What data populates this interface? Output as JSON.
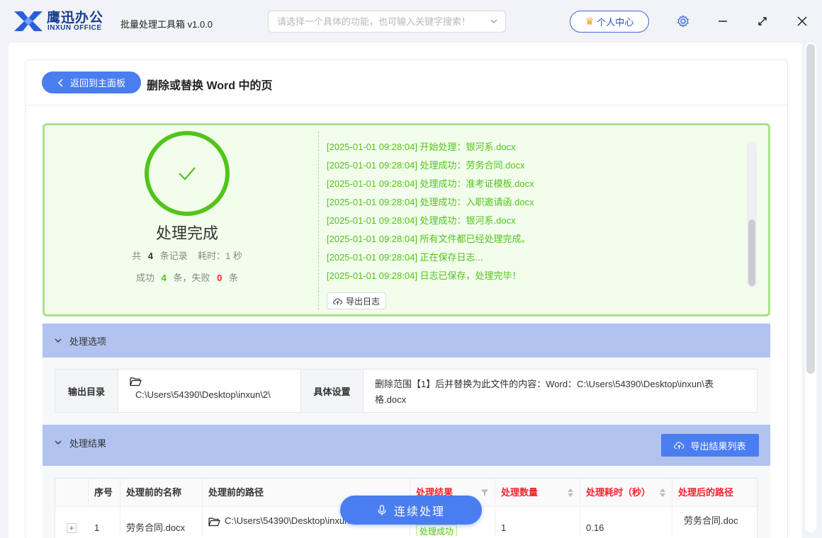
{
  "app": {
    "brand_cn": "鹰迅办公",
    "brand_en": "INXUN OFFICE",
    "title": "批量处理工具箱 v1.0.0"
  },
  "topbar": {
    "search_placeholder": "请选择一个具体的功能，也可输入关键字搜索！",
    "user_center": "个人中心"
  },
  "header": {
    "back_label": "返回到主面板",
    "page_title": "删除或替换 Word 中的页"
  },
  "result": {
    "status_title": "处理完成",
    "stat_total_prefix": "共",
    "total": "4",
    "stat_total_suffix": "条记录",
    "time_text": "耗时：1 秒",
    "success_prefix": "成功",
    "success": "4",
    "success_suffix": "条，失败",
    "fail": "0",
    "fail_suffix": "条",
    "export_log": "导出日志",
    "log": [
      "[2025-01-01 09:28:04] 开始处理：银河系.docx",
      "[2025-01-01 09:28:04] 处理成功：劳务合同.docx",
      "[2025-01-01 09:28:04] 处理成功：准考证模板.docx",
      "[2025-01-01 09:28:04] 处理成功：入职邀请函.docx",
      "[2025-01-01 09:28:04] 处理成功：银河系.docx",
      "[2025-01-01 09:28:04] 所有文件都已经处理完成。",
      "[2025-01-01 09:28:04] 正在保存日志...",
      "[2025-01-01 09:28:04] 日志已保存，处理完毕！"
    ]
  },
  "options": {
    "section_label": "处理选项",
    "output_dir_label": "输出目录",
    "output_dir": "C:\\Users\\54390\\Desktop\\inxun\\2\\",
    "settings_label": "具体设置",
    "settings_line1": "删除范围【1】后并替换为此文件的内容：Word：C:\\Users\\54390\\Desktop\\inxun\\表",
    "settings_line2": "格.docx"
  },
  "results": {
    "section_label": "处理结果",
    "export_list": "导出结果列表",
    "columns": [
      "序号",
      "处理前的名称",
      "处理前的路径",
      "处理结果",
      "处理数量",
      "处理耗时（秒）",
      "处理后的路径"
    ],
    "rows": [
      {
        "index": "1",
        "name": "劳务合同.docx",
        "path": "C:\\Users\\54390\\Desktop\\inxun",
        "status": "处理成功",
        "count": "1",
        "time": "0.16",
        "out_path": "劳务合同.doc"
      }
    ]
  },
  "continue_label": "连续处理",
  "colors": {
    "accent": "#4a7df0",
    "success": "#52c41a",
    "danger": "#f5222d",
    "section_bar": "#b1c3ee",
    "result_bg": "#f3fdec"
  }
}
